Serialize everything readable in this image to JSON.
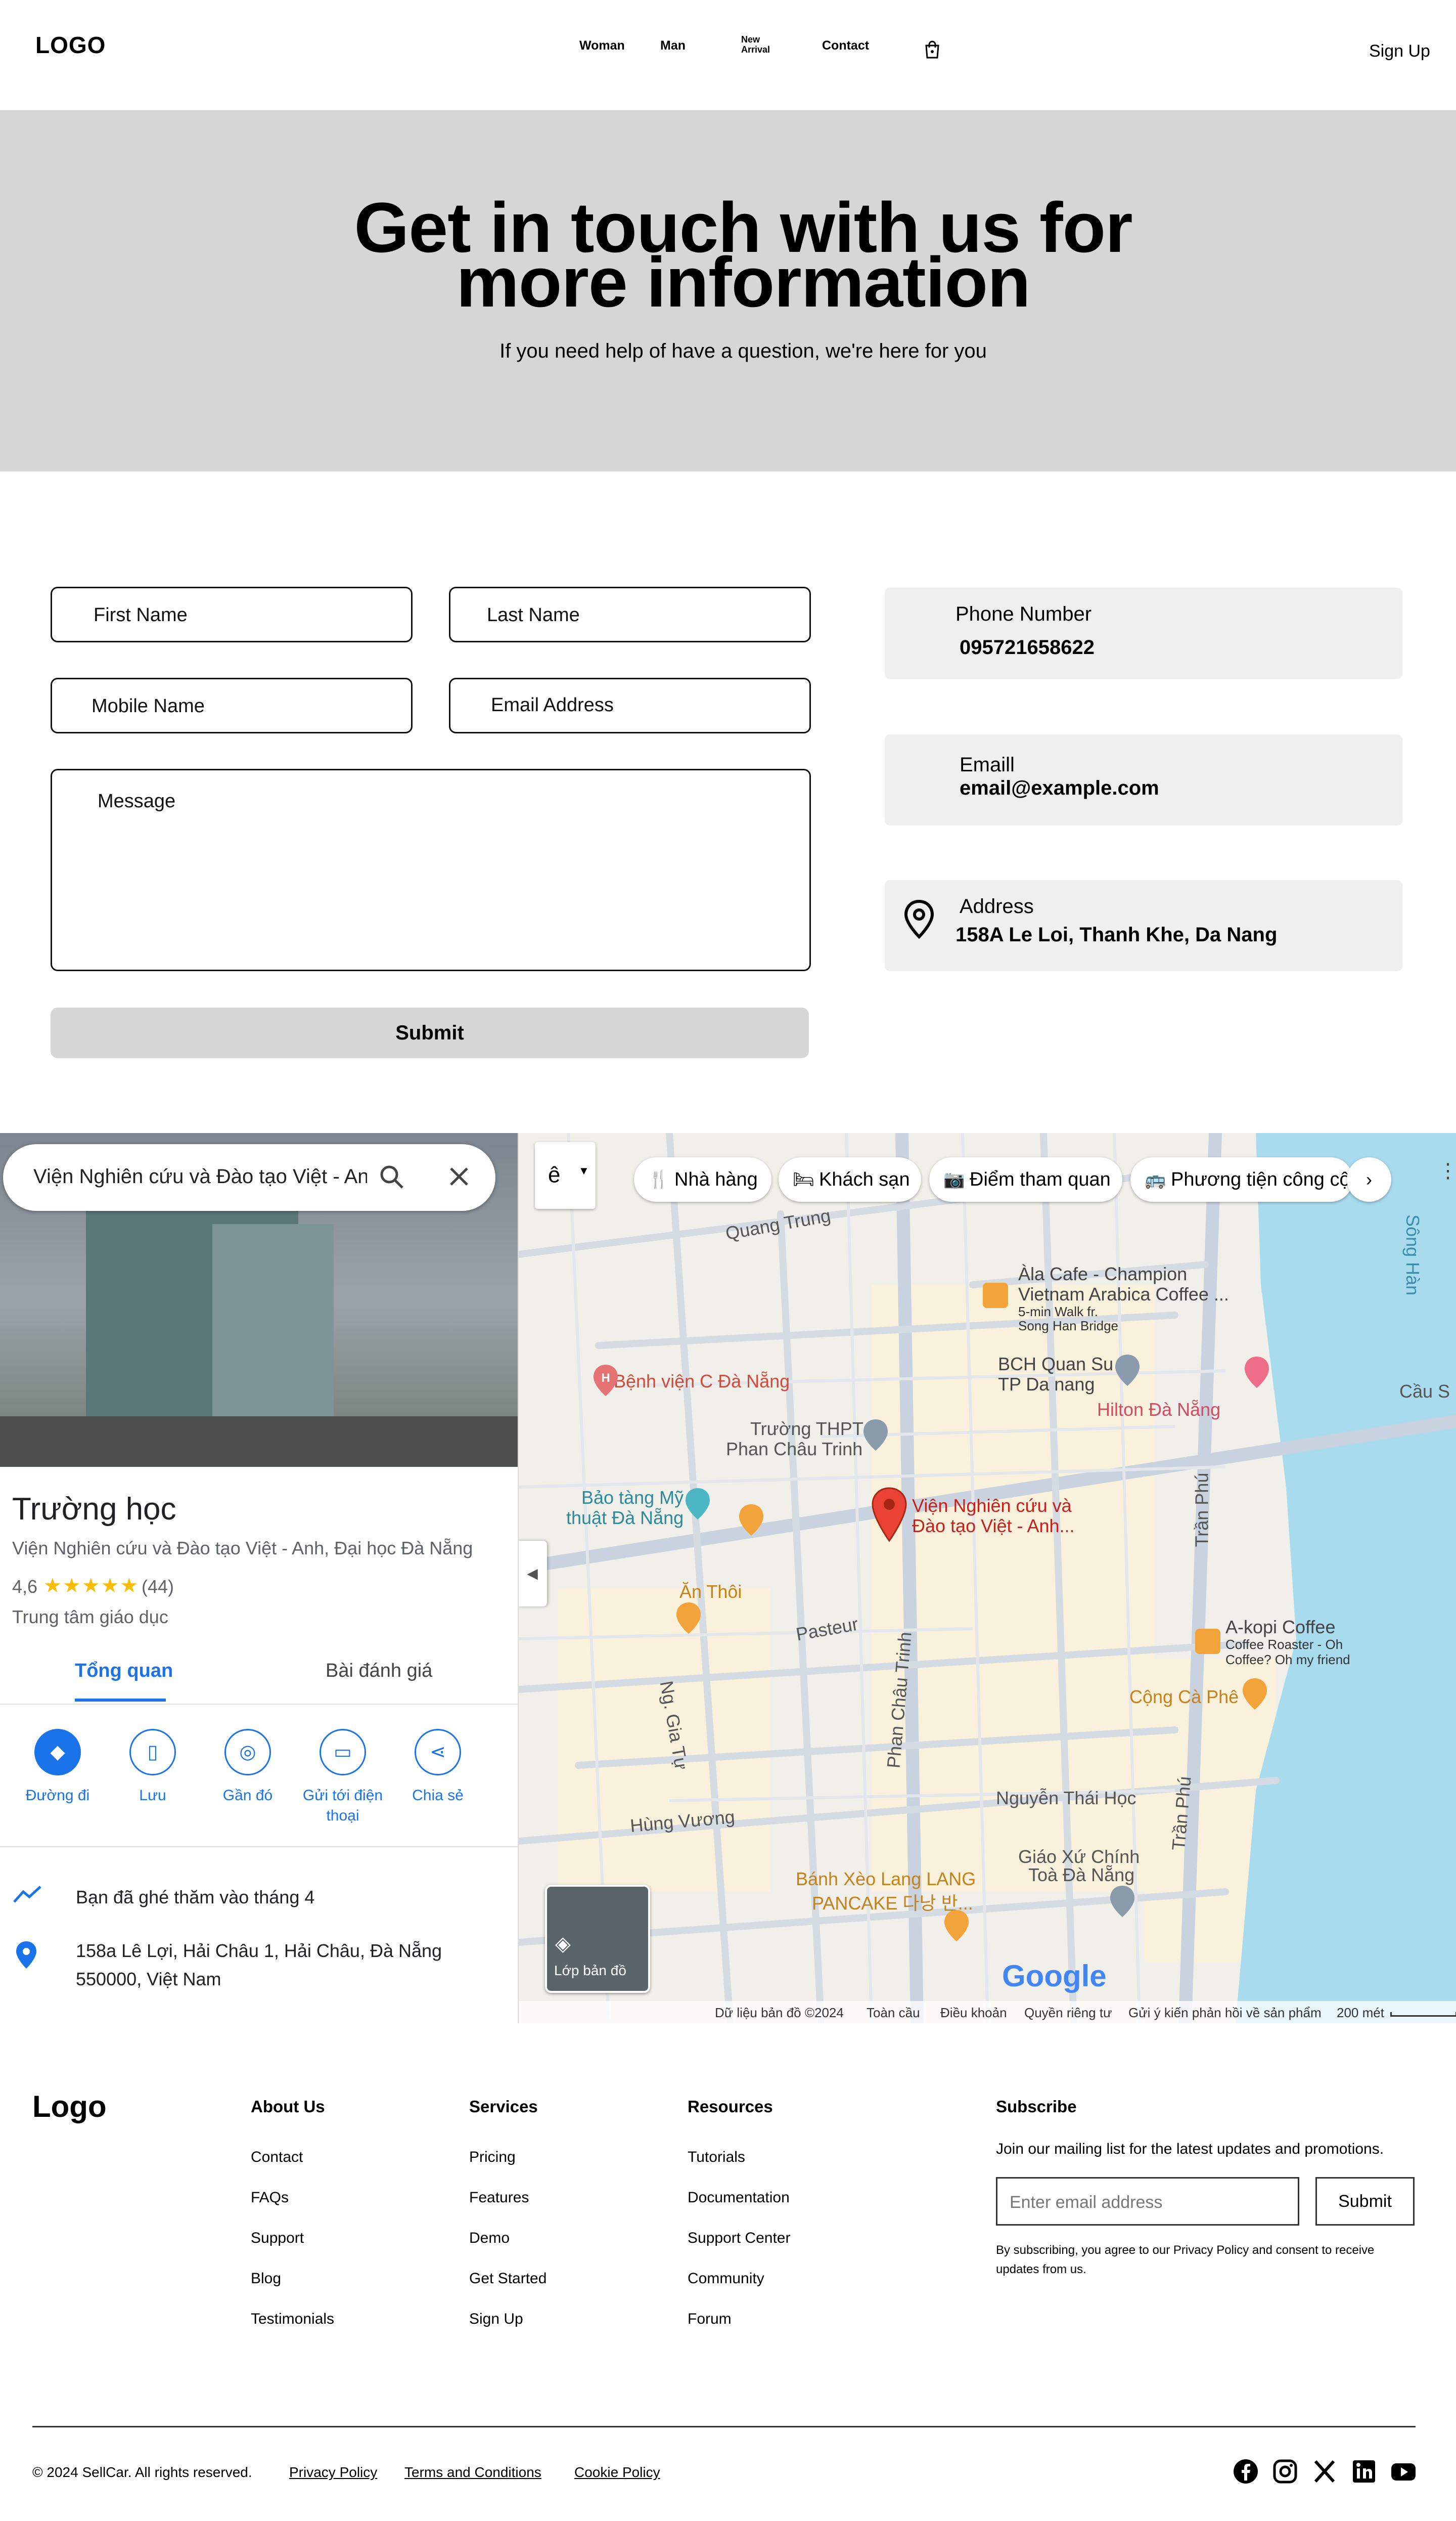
{
  "header": {
    "logo": "LOGO",
    "nav": [
      "Woman",
      "Man",
      "New Arrival",
      "Contact"
    ],
    "signup": "Sign Up"
  },
  "hero": {
    "title": "Get in touch with us for more information",
    "subtitle": "If you need help of have a question, we're here for you"
  },
  "form": {
    "first_name": "First Name",
    "last_name": "Last Name",
    "mobile": "Mobile Name",
    "email": "Email Address",
    "message": "Message",
    "submit": "Submit"
  },
  "contact": {
    "phone_label": "Phone Number",
    "phone_value": "095721658622",
    "email_label": "Emaill",
    "email_value": "email@example.com",
    "address_label": "Address",
    "address_value": "158A Le Loi, Thanh Khe, Da Nang"
  },
  "map": {
    "search_value": "Viện Nghiên cứu và Đào tạo Việt - Anh",
    "chips": [
      "Nhà hàng",
      "Khách sạn",
      "Điểm tham quan",
      "Phương tiện công cộ"
    ],
    "place": {
      "title": "Trường học",
      "name": "Viện Nghiên cứu và Đào tạo Việt - Anh, Đại học Đà Nẵng",
      "rating": "4,6",
      "reviews": "(44)",
      "category": "Trung tâm giáo dục",
      "tab_overview": "Tổng quan",
      "tab_reviews": "Bài đánh giá",
      "actions": [
        "Đường đi",
        "Lưu",
        "Gần đó",
        "Gửi tới điện thoại",
        "Chia sẻ"
      ],
      "visited": "Bạn đã ghé thăm vào tháng 4",
      "address_line1": "158a Lê Lợi, Hải Châu 1, Hải Châu, Đà Nẵng",
      "address_line2": "550000, Việt Nam"
    },
    "labels": {
      "quang_trung": "Quang Trung",
      "cafe1": "Àla Cafe - Champion",
      "cafe2": "Vietnam Arabica Coffee ...",
      "cafe3": "5-min Walk fr.",
      "cafe4": "Song Han Bridge",
      "song_han": "Sông Hàn",
      "cau_song": "Cầu S",
      "bch": "BCH Quan Su",
      "tp_dn": "TP Da nang",
      "hilton": "Hilton Đà Nẵng",
      "hospital": "Bệnh viện C Đà Nẵng",
      "school1": "Trường THPT",
      "school2": "Phan Châu Trinh",
      "museum1": "Bảo tàng Mỹ",
      "museum2": "thuật Đà Nẵng",
      "inst1": "Viện Nghiên cứu và",
      "inst2": "Đào tạo Việt - Anh...",
      "tran_phu": "Trần Phú",
      "an_thoi": "Ăn Thôi",
      "pasteur": "Pasteur",
      "akopi1": "A-kopi Coffee",
      "akopi2": "Coffee Roaster - Oh",
      "akopi3": "Coffee? Oh my friend",
      "cong": "Cộng Cà Phê",
      "ng_gia_tu": "Ng. Gia Tự",
      "phan_chau": "Phan Châu Trinh",
      "nguyen_thai_hoc": "Nguyễn Thái Học",
      "hung_vuong": "Hùng Vương",
      "tran_phu2": "Trần Phú",
      "giao_xu1": "Giáo Xứ Chính",
      "giao_xu2": "Toà Đà Nẵng",
      "banh_xeo1": "Bánh Xèo Lang LANG",
      "banh_xeo2": "PANCAKE 다낭 반...",
      "layers": "Lớp bản đồ",
      "google": "Google"
    },
    "footer": [
      "Dữ liệu bản đồ ©2024",
      "Toàn cầu",
      "Điều khoản",
      "Quyền riêng tư",
      "Gửi ý kiến phản hồi về sản phẩm",
      "200 mét"
    ]
  },
  "footer": {
    "logo": "Logo",
    "col1": {
      "title": "About Us",
      "links": [
        "Contact",
        "FAQs",
        "Support",
        "Blog",
        "Testimonials"
      ]
    },
    "col2": {
      "title": "Services",
      "links": [
        "Pricing",
        "Features",
        "Demo",
        "Get Started",
        "Sign Up"
      ]
    },
    "col3": {
      "title": "Resources",
      "links": [
        "Tutorials",
        "Documentation",
        "Support Center",
        "Community",
        "Forum"
      ]
    },
    "subscribe": {
      "title": "Subscribe",
      "text": "Join our mailing list for the latest updates and promotions.",
      "placeholder": "Enter email address",
      "button": "Submit",
      "note": "By subscribing, you agree to our Privacy Policy and consent to receive updates from us."
    },
    "copyright": "© 2024 SellCar. All rights reserved.",
    "legal": [
      "Privacy Policy",
      "Terms and Conditions",
      "Cookie Policy"
    ],
    "social": [
      "facebook-icon",
      "instagram-icon",
      "x-icon",
      "linkedin-icon",
      "youtube-icon"
    ]
  }
}
